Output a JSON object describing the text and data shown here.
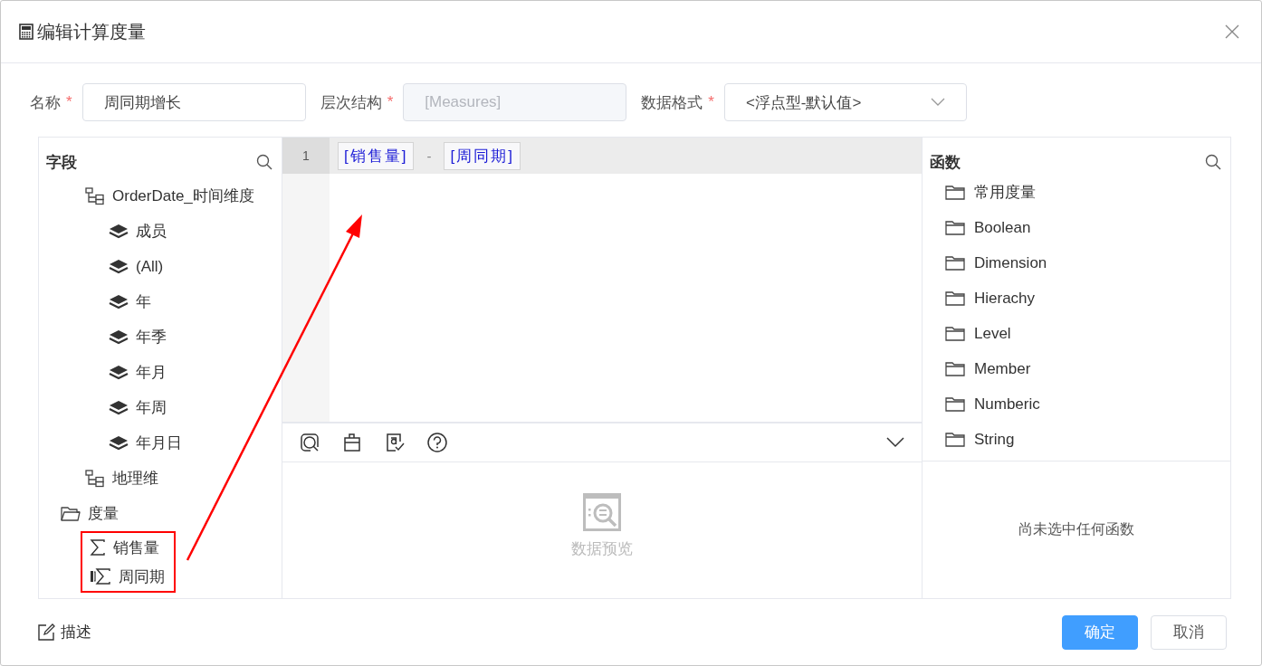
{
  "dialog": {
    "title": "编辑计算度量"
  },
  "form": [
    {
      "label": "名称",
      "required_mark": "*",
      "kind": "input",
      "value": "周同期增长",
      "disabled": false
    },
    {
      "label": "层次结构",
      "required_mark": "*",
      "kind": "input",
      "value": "[Measures]",
      "disabled": true
    },
    {
      "label": "数据格式",
      "required_mark": "*",
      "kind": "select",
      "value": "<浮点型-默认值>",
      "disabled": false
    }
  ],
  "fields": {
    "title": "字段",
    "tree": [
      {
        "label": "OrderDate_时间维度",
        "kind": "hierarchy",
        "children": [
          {
            "label": "成员",
            "kind": "level"
          },
          {
            "label": "(All)",
            "kind": "level"
          },
          {
            "label": "年",
            "kind": "level"
          },
          {
            "label": "年季",
            "kind": "level"
          },
          {
            "label": "年月",
            "kind": "level"
          },
          {
            "label": "年周",
            "kind": "level"
          },
          {
            "label": "年月日",
            "kind": "level"
          }
        ]
      },
      {
        "label": "地理维",
        "kind": "hierarchy"
      },
      {
        "label": "度量",
        "kind": "folder",
        "highlighted_children": true,
        "children": [
          {
            "label": "销售量",
            "kind": "measure"
          },
          {
            "label": "周同期",
            "kind": "calculated"
          }
        ]
      }
    ]
  },
  "editor": {
    "lines": [
      {
        "number": "1",
        "tokens": [
          {
            "kind": "field",
            "text": "[销售量]"
          },
          {
            "kind": "operator",
            "text": "-"
          },
          {
            "kind": "field",
            "text": "[周同期]"
          }
        ]
      }
    ],
    "preview": {
      "text": "数据预览"
    }
  },
  "functions": {
    "title": "函数",
    "items": [
      "常用度量",
      "Boolean",
      "Dimension",
      "Hierachy",
      "Level",
      "Member",
      "Numberic",
      "String"
    ],
    "empty_text": "尚未选中任何函数"
  },
  "footer": {
    "describe": "描述",
    "ok": "确定",
    "cancel": "取消"
  }
}
